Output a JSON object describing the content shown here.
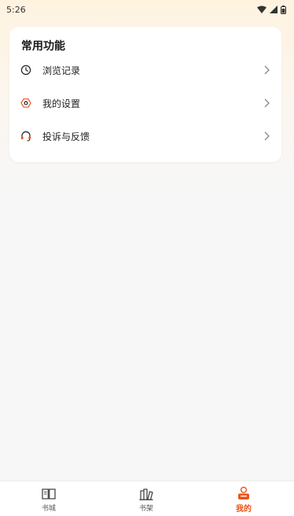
{
  "status_bar": {
    "time": "5:26"
  },
  "common_functions": {
    "title": "常用功能",
    "items": [
      {
        "label": "浏览记录",
        "icon": "clock-icon"
      },
      {
        "label": "我的设置",
        "icon": "gear-icon"
      },
      {
        "label": "投诉与反馈",
        "icon": "headset-icon"
      }
    ]
  },
  "tabbar": {
    "tabs": [
      {
        "label": "书城",
        "icon": "open-book-icon",
        "active": false
      },
      {
        "label": "书架",
        "icon": "bookshelf-icon",
        "active": false
      },
      {
        "label": "我的",
        "icon": "profile-icon",
        "active": true
      }
    ]
  },
  "colors": {
    "accent": "#e8551e",
    "background": "#f7f7f7",
    "header_gradient": "#fff3e0"
  }
}
